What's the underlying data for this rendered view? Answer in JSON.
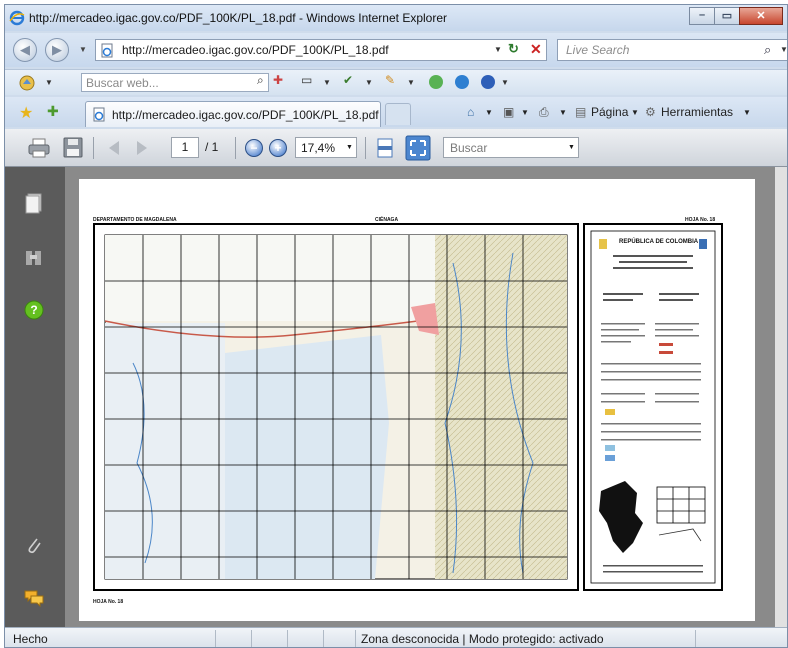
{
  "window": {
    "title": "http://mercadeo.igac.gov.co/PDF_100K/PL_18.pdf - Windows Internet Explorer"
  },
  "address_bar": {
    "url": "http://mercadeo.igac.gov.co/PDF_100K/PL_18.pdf"
  },
  "search": {
    "placeholder": "Live Search"
  },
  "toolbar": {
    "web_search_placeholder": "Buscar web..."
  },
  "tab": {
    "label": "http://mercadeo.igac.gov.co/PDF_100K/PL_18.pdf"
  },
  "command_bar": {
    "page_label": "Página",
    "tools_label": "Herramientas"
  },
  "pdf_toolbar": {
    "current_page": "1",
    "total_pages": "/ 1",
    "zoom": "17,4%",
    "search_placeholder": "Buscar"
  },
  "map_sheet": {
    "department": "DEPARTAMENTO DE MAGDALENA",
    "name": "CIÉNAGA",
    "sheet_top": "HOJA No. 18",
    "sheet_bottom": "HOJA No. 18",
    "country": "REPÚBLICA DE COLOMBIA"
  },
  "status": {
    "left": "Hecho",
    "zone": "Zona desconocida | Modo protegido: activado"
  },
  "colors": {
    "accent": "#2f6bc6",
    "panel": "#5b5b5b",
    "viewer_bg": "#8a8a8a",
    "water": "#dce8f2"
  }
}
